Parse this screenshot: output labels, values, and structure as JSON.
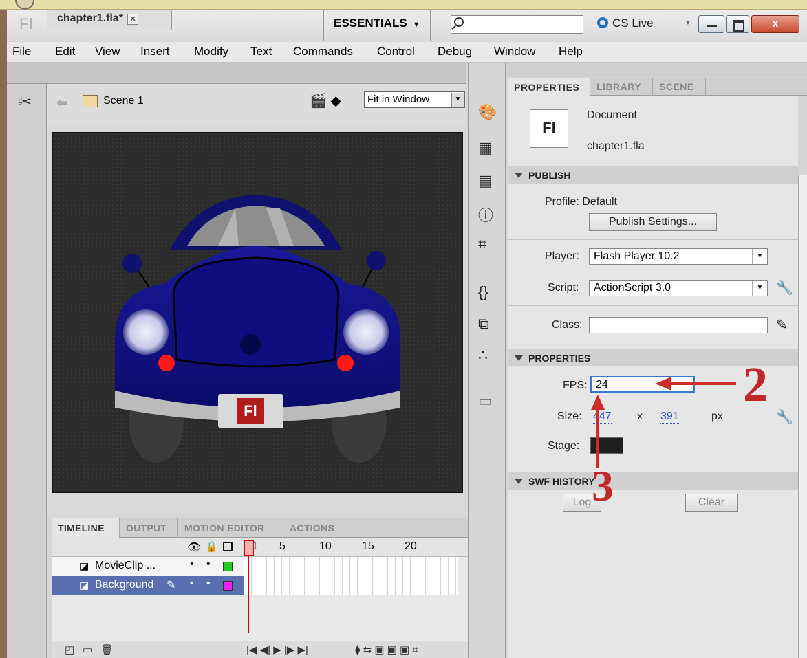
{
  "window": {
    "logo": "Fl",
    "workspace": "ESSENTIALS",
    "search_placeholder": "",
    "cs_live": "CS Live",
    "close": "x"
  },
  "menu": [
    "File",
    "Edit",
    "View",
    "Insert",
    "Modify",
    "Text",
    "Commands",
    "Control",
    "Debug",
    "Window",
    "Help"
  ],
  "document": {
    "tab_name": "chapter1.fla*",
    "scene": "Scene 1",
    "zoom": "Fit in Window",
    "plate_logo": "Fl"
  },
  "panel": {
    "tabs": [
      "PROPERTIES",
      "LIBRARY",
      "SCENE"
    ],
    "doc_type": "Document",
    "doc_icon": "Fl",
    "doc_name": "chapter1.fla",
    "publish": {
      "header": "PUBLISH",
      "profile": "Profile: Default",
      "publish_settings": "Publish Settings...",
      "player_label": "Player:",
      "player": "Flash Player 10.2",
      "script_label": "Script:",
      "script": "ActionScript 3.0",
      "class_label": "Class:",
      "class_value": ""
    },
    "properties": {
      "header": "PROPERTIES",
      "fps_label": "FPS:",
      "fps": "24",
      "size_label": "Size:",
      "width": "447",
      "x": "x",
      "height": "391",
      "unit": "px",
      "stage_label": "Stage:",
      "stage_color": "#1e1e1e"
    },
    "swf_history": {
      "header": "SWF HISTORY",
      "log": "Log",
      "clear": "Clear"
    }
  },
  "timeline": {
    "tabs": [
      "TIMELINE",
      "OUTPUT",
      "MOTION EDITOR",
      "ACTIONS"
    ],
    "ruler": [
      "1",
      "5",
      "10",
      "15",
      "20"
    ],
    "layers": [
      {
        "name": "MovieClip ...",
        "color": "#22cc22"
      },
      {
        "name": "Background",
        "color": "#ee22ee"
      }
    ]
  },
  "annotations": {
    "two": "2",
    "three": "3"
  }
}
